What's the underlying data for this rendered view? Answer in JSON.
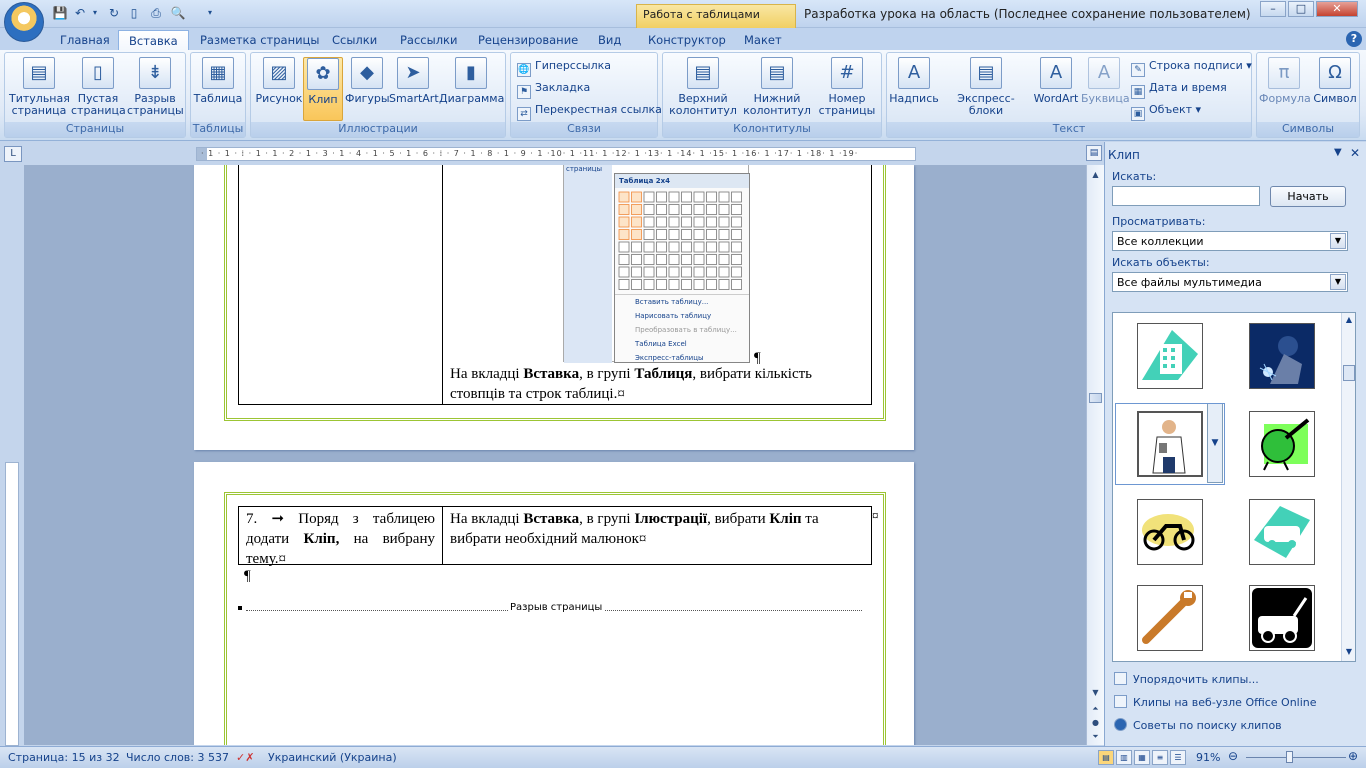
{
  "window": {
    "title": "Разработка урока на область (Последнее сохранение пользователем) [Режим ...",
    "context_tab_group": "Работа с таблицами",
    "buttons": {
      "minimize": "–",
      "maximize": "□",
      "close": "✕"
    }
  },
  "tabs": [
    "Главная",
    "Вставка",
    "Разметка страницы",
    "Ссылки",
    "Рассылки",
    "Рецензирование",
    "Вид",
    "Конструктор",
    "Макет"
  ],
  "active_tab": "Вставка",
  "ribbon": {
    "pages": {
      "label": "Страницы",
      "title_page": "Титульная страница",
      "blank_page": "Пустая страница",
      "page_break": "Разрыв страницы"
    },
    "tables": {
      "label": "Таблицы",
      "table": "Таблица"
    },
    "illustrations": {
      "label": "Иллюстрации",
      "picture": "Рисунок",
      "clip": "Клип",
      "shapes": "Фигуры",
      "smartart": "SmartArt",
      "chart": "Диаграмма"
    },
    "links": {
      "label": "Связи",
      "hyperlink": "Гиперссылка",
      "bookmark": "Закладка",
      "cross_reference": "Перекрестная ссылка"
    },
    "header_footer": {
      "label": "Колонтитулы",
      "header": "Верхний колонтитул",
      "footer": "Нижний колонтитул",
      "page_number": "Номер страницы"
    },
    "text": {
      "label": "Текст",
      "textbox": "Надпись",
      "quick_parts": "Экспресс-блоки",
      "wordart": "WordArt",
      "dropcap": "Буквица",
      "signature_line": "Строка подписи",
      "date_time": "Дата и время",
      "object": "Объект"
    },
    "symbols": {
      "label": "Символы",
      "equation": "Формула",
      "symbol": "Символ"
    }
  },
  "document": {
    "page1_caption_1": "На вкладці ",
    "page1_caption_b1": "Вставка",
    "page1_caption_2": ", в групі ",
    "page1_caption_b2": "Таблиця",
    "page1_caption_3": ", вибрати кількість",
    "page1_caption_line2": "стовпців та строк таблиці.¤",
    "embedded_table_menu": {
      "header": "Таблица 2x4",
      "tab_fragment": "страницы",
      "items": [
        "Вставить таблицу...",
        "Нарисовать таблицу",
        "Преобразовать в таблицу...",
        "Таблица Excel",
        "Экспресс-таблицы"
      ]
    },
    "pilcrow": "¶",
    "row7_left_1": "7. ➞ Поряд з таблицею додати ",
    "row7_left_b": "Кліп,",
    "row7_left_2": " на вибрану тему.¤",
    "row7_right_1": "На вкладці ",
    "row7_right_b1": "Вставка",
    "row7_right_2": ", в групі ",
    "row7_right_b2": "Ілюстрації",
    "row7_right_3": ", вибрати ",
    "row7_right_b3": "Кліп",
    "row7_right_4": " та вибрати необхідний малюнок¤",
    "cell_marker": "¤",
    "page_break_label": "Разрыв страницы"
  },
  "ruler_marks": "· 1 · 1 · ⁞ · 1 · 1 · 2 · 1 · 3 · 1 · 4 · 1 · 5 · 1 · 6 · ⁞ · 7 · 1 · 8 · 1 · 9 · 1 ·10· 1 ·11· 1 ·12· 1 ·13· 1 ·14· 1 ·15· 1 ·16· 1 ·17· 1 ·18· 1 ·19·",
  "clip_panel": {
    "title": "Клип",
    "search_label": "Искать:",
    "search_value": "",
    "go_button": "Начать",
    "browse_label": "Просматривать:",
    "browse_value": "Все коллекции",
    "types_label": "Искать объекты:",
    "types_value": "Все файлы мультимедиа",
    "thumbnails": [
      "hospital-building",
      "welder",
      "doctor",
      "globe-rocket",
      "motorcycle",
      "taxi",
      "wrench",
      "tow-truck"
    ],
    "links": [
      "Упорядочить клипы...",
      "Клипы на веб-узле Office Online",
      "Советы по поиску клипов"
    ]
  },
  "statusbar": {
    "page": "Страница: 15 из 32",
    "words": "Число слов: 3 537",
    "language": "Украинский (Украина)",
    "zoom": "91%"
  },
  "colors": {
    "accent": "#15428b",
    "frame": "#9cc534",
    "ribbon_bg": "#dfe9f6"
  }
}
